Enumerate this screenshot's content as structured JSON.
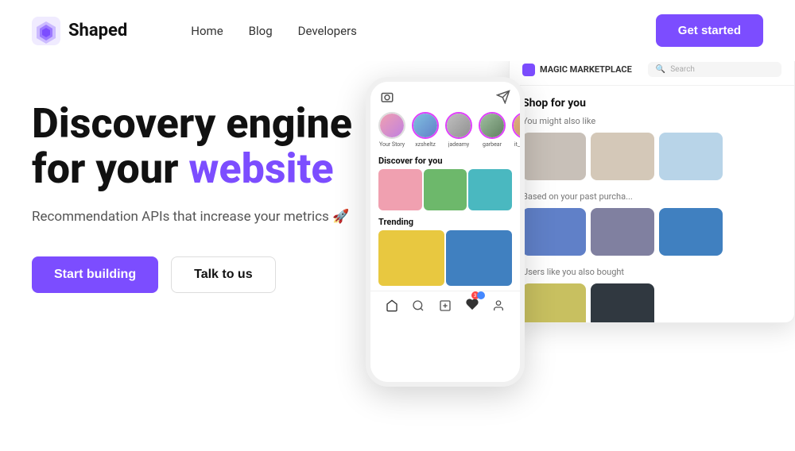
{
  "nav": {
    "logo_text": "Shaped",
    "links": [
      {
        "label": "Home",
        "id": "home"
      },
      {
        "label": "Blog",
        "id": "blog"
      },
      {
        "label": "Developers",
        "id": "developers"
      }
    ],
    "cta_label": "Get started"
  },
  "hero": {
    "title_line1": "Discovery engine",
    "title_line2_plain": "for your ",
    "title_line2_accent": "website",
    "subtitle": "Recommendation APIs that increase your metrics 🚀",
    "btn_primary": "Start building",
    "btn_secondary": "Talk to us"
  },
  "phone": {
    "sections": {
      "discover": "Discover for you",
      "trending": "Trending"
    },
    "stories": [
      {
        "label": "Your Story"
      },
      {
        "label": "xzsheltz"
      },
      {
        "label": "jadeamy"
      },
      {
        "label": "garbear"
      },
      {
        "label": "it_and_bt"
      }
    ]
  },
  "desktop": {
    "brand": "MAGIC MARKETPLACE",
    "search_placeholder": "Search",
    "section_main": "Shop for you",
    "section1": "You might also like",
    "section2": "Based on your past purcha...",
    "section3": "Users like you also bought"
  }
}
